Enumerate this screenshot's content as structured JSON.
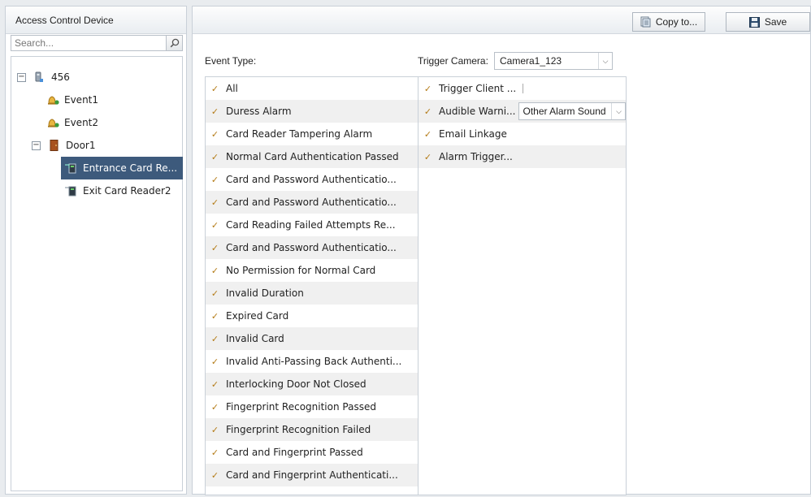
{
  "left": {
    "title": "Access Control Device",
    "search_placeholder": "Search...",
    "tree": [
      {
        "label": "456",
        "icon": "device-icon",
        "toggle": "−"
      },
      {
        "label": "Event1",
        "icon": "event-bell-icon"
      },
      {
        "label": "Event2",
        "icon": "event-bell-icon"
      },
      {
        "label": "Door1",
        "icon": "door-icon",
        "toggle": "−"
      },
      {
        "label": "Entrance Card Re...",
        "icon": "card-reader-icon",
        "selected": true
      },
      {
        "label": "Exit Card Reader2",
        "icon": "card-reader-icon"
      }
    ]
  },
  "toolbar": {
    "copy_label": "Copy to...",
    "save_label": "Save"
  },
  "event_type_label": "Event Type:",
  "trigger_camera_label": "Trigger Camera:",
  "trigger_camera_value": "Camera1_123",
  "events": [
    "All",
    "Duress Alarm",
    "Card Reader Tampering Alarm",
    "Normal Card Authentication Passed",
    "Card and Password Authenticatio...",
    "Card and Password Authenticatio...",
    "Card Reading Failed Attempts Re...",
    "Card and Password Authenticatio...",
    "No Permission for Normal Card",
    "Invalid Duration",
    "Expired Card",
    "Invalid Card",
    "Invalid Anti-Passing Back Authenti...",
    "Interlocking Door Not Closed",
    "Fingerprint Recognition Passed",
    "Fingerprint Recognition Failed",
    "Card and Fingerprint Passed",
    "Card and Fingerprint Authenticati..."
  ],
  "linkages": {
    "trigger_client": "Trigger Client ...",
    "audible_warning": "Audible Warni...",
    "audible_sound_value": "Other Alarm Sound",
    "email_linkage": "Email Linkage",
    "alarm_trigger": "Alarm Trigger..."
  },
  "colors": {
    "selected_row": "#3d5a7c",
    "checkmark": "#b47b16",
    "alt_row": "#f0f0f0"
  }
}
